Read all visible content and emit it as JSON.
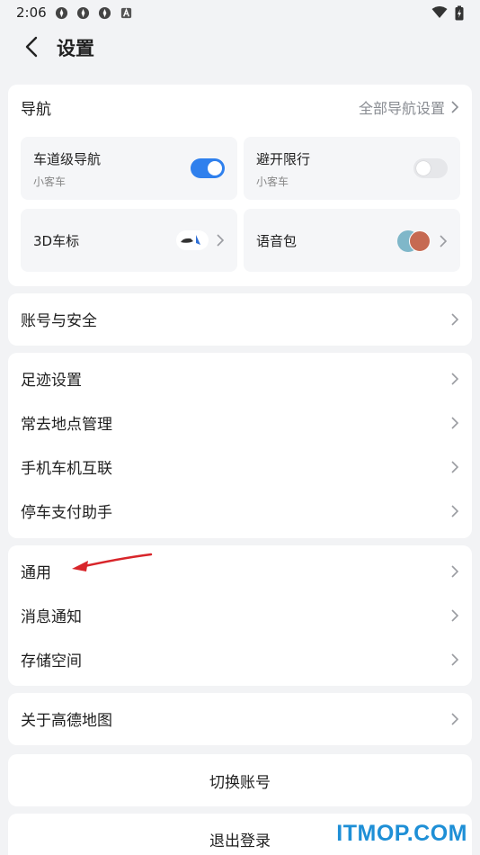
{
  "status_bar": {
    "time": "2:06",
    "icons": [
      "app-notification-icon",
      "app-notification-icon",
      "app-notification-icon",
      "a-box-icon"
    ],
    "right_icons": [
      "wifi-icon",
      "battery-charging-icon"
    ]
  },
  "header": {
    "title": "设置"
  },
  "nav": {
    "label": "导航",
    "all_settings": "全部导航设置",
    "lane_nav": {
      "title": "车道级导航",
      "sub": "小客车",
      "enabled": true
    },
    "avoid_limit": {
      "title": "避开限行",
      "sub": "小客车",
      "enabled": false
    },
    "car_3d": {
      "title": "3D车标"
    },
    "voice_pack": {
      "title": "语音包"
    }
  },
  "account": {
    "label": "账号与安全"
  },
  "group2": {
    "items": [
      "足迹设置",
      "常去地点管理",
      "手机车机互联",
      "停车支付助手"
    ]
  },
  "group3": {
    "items": [
      "通用",
      "消息通知",
      "存储空间"
    ]
  },
  "about": {
    "label": "关于高德地图"
  },
  "switch_account": "切换账号",
  "logout": "退出登录",
  "watermark": "ITMOP.COM",
  "colors": {
    "accent": "#2f80ed",
    "annotation_arrow": "#d8252a",
    "background": "#f2f3f5",
    "watermark": "#1e8fd6"
  }
}
